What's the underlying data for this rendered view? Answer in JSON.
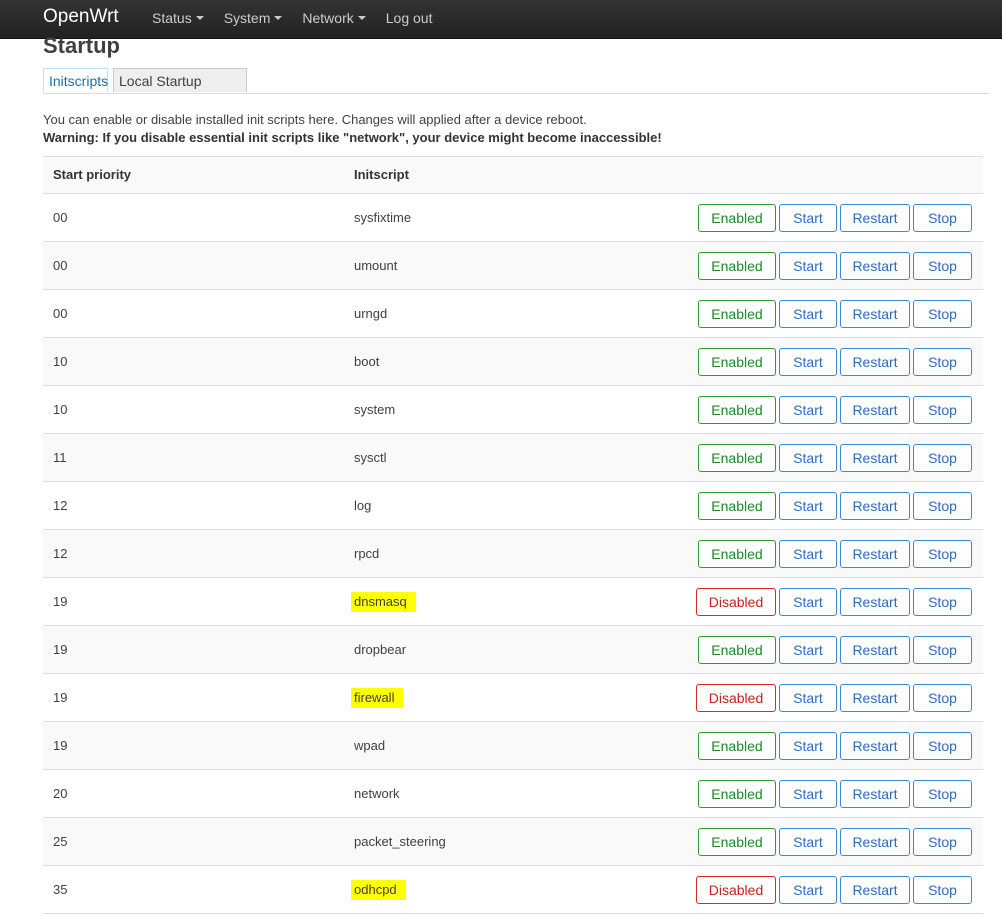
{
  "navbar": {
    "brand": "OpenWrt",
    "menu": [
      {
        "label": "Status",
        "dropdown": true
      },
      {
        "label": "System",
        "dropdown": true
      },
      {
        "label": "Network",
        "dropdown": true
      },
      {
        "label": "Log out",
        "dropdown": false
      }
    ]
  },
  "page": {
    "title": "Startup",
    "tabs": [
      {
        "label": "Initscripts",
        "active": true
      },
      {
        "label": "Local Startup",
        "active": false
      }
    ],
    "description": "You can enable or disable installed init scripts here. Changes will applied after a device reboot.",
    "warning": "Warning: If you disable essential init scripts like \"network\", your device might become inaccessible!"
  },
  "table": {
    "headers": {
      "priority": "Start priority",
      "initscript": "Initscript"
    },
    "buttons": {
      "start": "Start",
      "restart": "Restart",
      "stop": "Stop"
    },
    "state_labels": {
      "enabled": "Enabled",
      "disabled": "Disabled"
    },
    "rows": [
      {
        "priority": "00",
        "name": "sysfixtime",
        "enabled": true,
        "highlighted": false
      },
      {
        "priority": "00",
        "name": "umount",
        "enabled": true,
        "highlighted": false
      },
      {
        "priority": "00",
        "name": "urngd",
        "enabled": true,
        "highlighted": false
      },
      {
        "priority": "10",
        "name": "boot",
        "enabled": true,
        "highlighted": false
      },
      {
        "priority": "10",
        "name": "system",
        "enabled": true,
        "highlighted": false
      },
      {
        "priority": "11",
        "name": "sysctl",
        "enabled": true,
        "highlighted": false
      },
      {
        "priority": "12",
        "name": "log",
        "enabled": true,
        "highlighted": false
      },
      {
        "priority": "12",
        "name": "rpcd",
        "enabled": true,
        "highlighted": false
      },
      {
        "priority": "19",
        "name": "dnsmasq",
        "enabled": false,
        "highlighted": true
      },
      {
        "priority": "19",
        "name": "dropbear",
        "enabled": true,
        "highlighted": false
      },
      {
        "priority": "19",
        "name": "firewall",
        "enabled": false,
        "highlighted": true
      },
      {
        "priority": "19",
        "name": "wpad",
        "enabled": true,
        "highlighted": false
      },
      {
        "priority": "20",
        "name": "network",
        "enabled": true,
        "highlighted": false
      },
      {
        "priority": "25",
        "name": "packet_steering",
        "enabled": true,
        "highlighted": false
      },
      {
        "priority": "35",
        "name": "odhcpd",
        "enabled": false,
        "highlighted": true
      }
    ]
  },
  "colors": {
    "navbar_bg": "#222222",
    "link_blue": "#2a6cbf",
    "enabled_green": "#1a8a2a",
    "disabled_red": "#c82020",
    "highlight_yellow": "#ffff00"
  }
}
